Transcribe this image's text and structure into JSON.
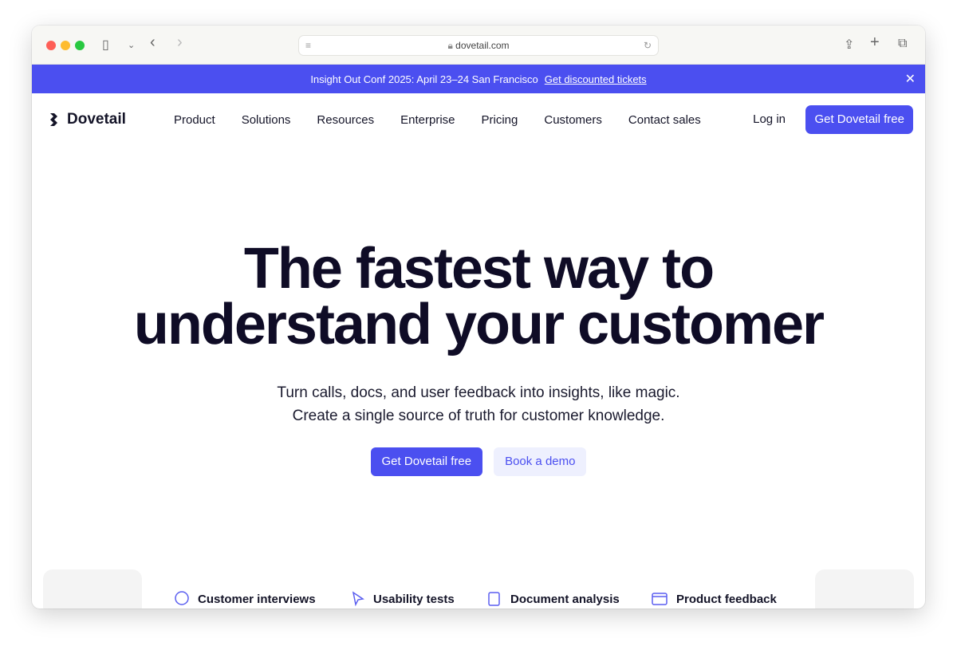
{
  "browser": {
    "url": "dovetail.com"
  },
  "banner": {
    "text": "Insight Out Conf 2025: April 23–24 San Francisco",
    "link": "Get discounted tickets",
    "close": "✕"
  },
  "nav": {
    "logo": "Dovetail",
    "items": [
      "Product",
      "Solutions",
      "Resources",
      "Enterprise",
      "Pricing",
      "Customers",
      "Contact sales"
    ],
    "login": "Log in",
    "cta": "Get Dovetail free"
  },
  "hero": {
    "title_line1": "The fastest way to",
    "title_line2": "understand your customer",
    "sub_line1": "Turn calls, docs, and user feedback into insights, like magic.",
    "sub_line2": "Create a single source of truth for customer knowledge.",
    "primary": "Get Dovetail free",
    "secondary": "Book a demo"
  },
  "tabs": [
    "Customer interviews",
    "Usability tests",
    "Document analysis",
    "Product feedback"
  ],
  "colors": {
    "accent": "#4b4ff0"
  }
}
